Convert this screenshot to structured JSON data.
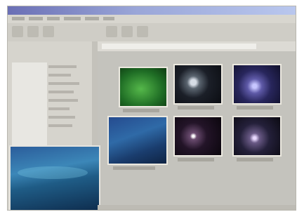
{
  "window": {
    "title": "",
    "menu_labels": [
      "",
      "",
      "",
      "",
      "",
      ""
    ]
  },
  "toolbar": {
    "buttons": [
      "back-icon",
      "forward-icon",
      "up-icon",
      "search-icon",
      "folders-icon",
      "views-icon"
    ]
  },
  "sidebar": {
    "tree_items": [
      "",
      "",
      "",
      "",
      "",
      "",
      "",
      ""
    ]
  },
  "thumbnails": [
    {
      "caption": "",
      "kind": "green-nebula"
    },
    {
      "caption": "",
      "kind": "galaxy"
    },
    {
      "caption": "",
      "kind": "blue-nebula"
    },
    {
      "caption": "",
      "kind": "underwater"
    },
    {
      "caption": "",
      "kind": "starfield"
    },
    {
      "caption": "",
      "kind": "starfield-purple"
    }
  ],
  "preview": {
    "label": ""
  },
  "status": {
    "text": ""
  }
}
